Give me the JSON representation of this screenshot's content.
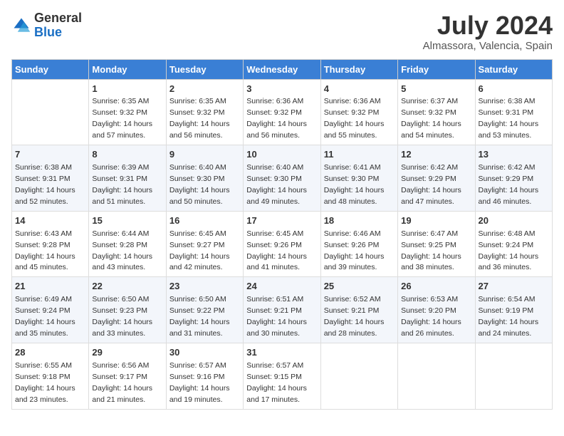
{
  "header": {
    "logo_general": "General",
    "logo_blue": "Blue",
    "month_year": "July 2024",
    "location": "Almassora, Valencia, Spain"
  },
  "days_of_week": [
    "Sunday",
    "Monday",
    "Tuesday",
    "Wednesday",
    "Thursday",
    "Friday",
    "Saturday"
  ],
  "weeks": [
    [
      {
        "day": "",
        "info": ""
      },
      {
        "day": "1",
        "info": "Sunrise: 6:35 AM\nSunset: 9:32 PM\nDaylight: 14 hours\nand 57 minutes."
      },
      {
        "day": "2",
        "info": "Sunrise: 6:35 AM\nSunset: 9:32 PM\nDaylight: 14 hours\nand 56 minutes."
      },
      {
        "day": "3",
        "info": "Sunrise: 6:36 AM\nSunset: 9:32 PM\nDaylight: 14 hours\nand 56 minutes."
      },
      {
        "day": "4",
        "info": "Sunrise: 6:36 AM\nSunset: 9:32 PM\nDaylight: 14 hours\nand 55 minutes."
      },
      {
        "day": "5",
        "info": "Sunrise: 6:37 AM\nSunset: 9:32 PM\nDaylight: 14 hours\nand 54 minutes."
      },
      {
        "day": "6",
        "info": "Sunrise: 6:38 AM\nSunset: 9:31 PM\nDaylight: 14 hours\nand 53 minutes."
      }
    ],
    [
      {
        "day": "7",
        "info": "Sunrise: 6:38 AM\nSunset: 9:31 PM\nDaylight: 14 hours\nand 52 minutes."
      },
      {
        "day": "8",
        "info": "Sunrise: 6:39 AM\nSunset: 9:31 PM\nDaylight: 14 hours\nand 51 minutes."
      },
      {
        "day": "9",
        "info": "Sunrise: 6:40 AM\nSunset: 9:30 PM\nDaylight: 14 hours\nand 50 minutes."
      },
      {
        "day": "10",
        "info": "Sunrise: 6:40 AM\nSunset: 9:30 PM\nDaylight: 14 hours\nand 49 minutes."
      },
      {
        "day": "11",
        "info": "Sunrise: 6:41 AM\nSunset: 9:30 PM\nDaylight: 14 hours\nand 48 minutes."
      },
      {
        "day": "12",
        "info": "Sunrise: 6:42 AM\nSunset: 9:29 PM\nDaylight: 14 hours\nand 47 minutes."
      },
      {
        "day": "13",
        "info": "Sunrise: 6:42 AM\nSunset: 9:29 PM\nDaylight: 14 hours\nand 46 minutes."
      }
    ],
    [
      {
        "day": "14",
        "info": "Sunrise: 6:43 AM\nSunset: 9:28 PM\nDaylight: 14 hours\nand 45 minutes."
      },
      {
        "day": "15",
        "info": "Sunrise: 6:44 AM\nSunset: 9:28 PM\nDaylight: 14 hours\nand 43 minutes."
      },
      {
        "day": "16",
        "info": "Sunrise: 6:45 AM\nSunset: 9:27 PM\nDaylight: 14 hours\nand 42 minutes."
      },
      {
        "day": "17",
        "info": "Sunrise: 6:45 AM\nSunset: 9:26 PM\nDaylight: 14 hours\nand 41 minutes."
      },
      {
        "day": "18",
        "info": "Sunrise: 6:46 AM\nSunset: 9:26 PM\nDaylight: 14 hours\nand 39 minutes."
      },
      {
        "day": "19",
        "info": "Sunrise: 6:47 AM\nSunset: 9:25 PM\nDaylight: 14 hours\nand 38 minutes."
      },
      {
        "day": "20",
        "info": "Sunrise: 6:48 AM\nSunset: 9:24 PM\nDaylight: 14 hours\nand 36 minutes."
      }
    ],
    [
      {
        "day": "21",
        "info": "Sunrise: 6:49 AM\nSunset: 9:24 PM\nDaylight: 14 hours\nand 35 minutes."
      },
      {
        "day": "22",
        "info": "Sunrise: 6:50 AM\nSunset: 9:23 PM\nDaylight: 14 hours\nand 33 minutes."
      },
      {
        "day": "23",
        "info": "Sunrise: 6:50 AM\nSunset: 9:22 PM\nDaylight: 14 hours\nand 31 minutes."
      },
      {
        "day": "24",
        "info": "Sunrise: 6:51 AM\nSunset: 9:21 PM\nDaylight: 14 hours\nand 30 minutes."
      },
      {
        "day": "25",
        "info": "Sunrise: 6:52 AM\nSunset: 9:21 PM\nDaylight: 14 hours\nand 28 minutes."
      },
      {
        "day": "26",
        "info": "Sunrise: 6:53 AM\nSunset: 9:20 PM\nDaylight: 14 hours\nand 26 minutes."
      },
      {
        "day": "27",
        "info": "Sunrise: 6:54 AM\nSunset: 9:19 PM\nDaylight: 14 hours\nand 24 minutes."
      }
    ],
    [
      {
        "day": "28",
        "info": "Sunrise: 6:55 AM\nSunset: 9:18 PM\nDaylight: 14 hours\nand 23 minutes."
      },
      {
        "day": "29",
        "info": "Sunrise: 6:56 AM\nSunset: 9:17 PM\nDaylight: 14 hours\nand 21 minutes."
      },
      {
        "day": "30",
        "info": "Sunrise: 6:57 AM\nSunset: 9:16 PM\nDaylight: 14 hours\nand 19 minutes."
      },
      {
        "day": "31",
        "info": "Sunrise: 6:57 AM\nSunset: 9:15 PM\nDaylight: 14 hours\nand 17 minutes."
      },
      {
        "day": "",
        "info": ""
      },
      {
        "day": "",
        "info": ""
      },
      {
        "day": "",
        "info": ""
      }
    ]
  ]
}
